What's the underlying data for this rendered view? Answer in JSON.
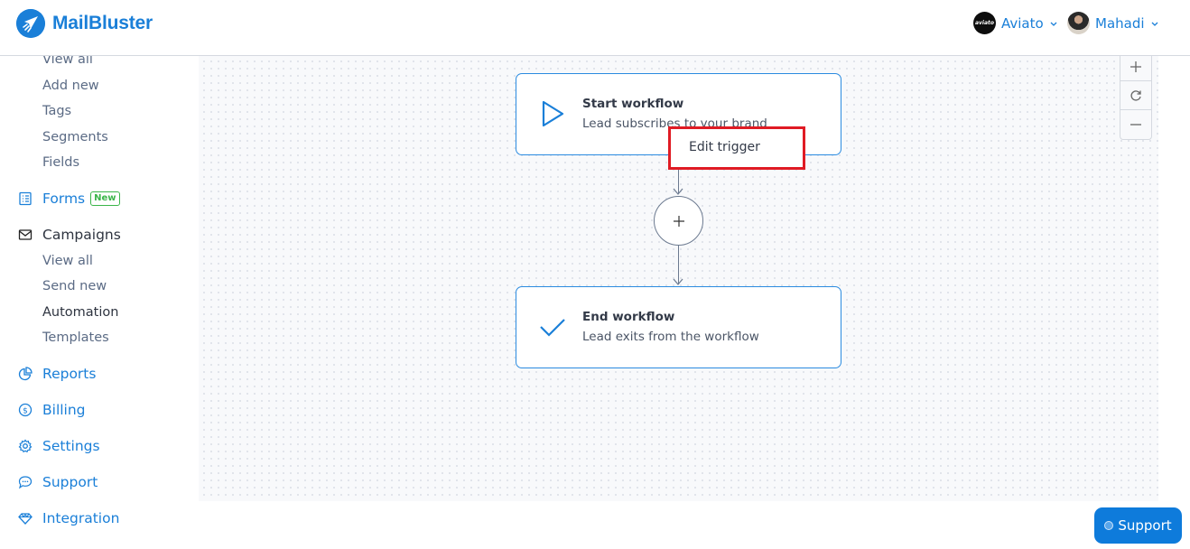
{
  "app": {
    "name": "MailBluster",
    "brand_color": "#1a7fd8"
  },
  "header": {
    "org": {
      "name": "Aviato",
      "avatar_text": "aviato"
    },
    "user": {
      "name": "Mahadi"
    }
  },
  "sidebar": {
    "subscribers_items": [
      {
        "label": "View all"
      },
      {
        "label": "Add new"
      },
      {
        "label": "Tags"
      },
      {
        "label": "Segments"
      },
      {
        "label": "Fields"
      }
    ],
    "forms": {
      "label": "Forms",
      "badge": "New"
    },
    "campaigns": {
      "label": "Campaigns",
      "items": [
        {
          "label": "View all"
        },
        {
          "label": "Send new"
        },
        {
          "label": "Automation",
          "active": true
        },
        {
          "label": "Templates"
        }
      ]
    },
    "bottom_items": [
      {
        "label": "Reports",
        "icon": "reports-icon"
      },
      {
        "label": "Billing",
        "icon": "billing-icon"
      },
      {
        "label": "Settings",
        "icon": "settings-icon"
      },
      {
        "label": "Support",
        "icon": "support-chat-icon"
      },
      {
        "label": "Integration",
        "icon": "integration-icon"
      }
    ]
  },
  "workflow": {
    "start": {
      "title": "Start workflow",
      "description": "Lead subscribes to your brand"
    },
    "add_step_symbol": "+",
    "end": {
      "title": "End workflow",
      "description": "Lead exits from the workflow"
    },
    "context_menu": {
      "items": [
        {
          "label": "Edit trigger"
        }
      ]
    }
  },
  "zoom_controls": {
    "zoom_in": "+",
    "reset": "reset",
    "zoom_out": "−"
  },
  "support_button": {
    "label": "Support"
  }
}
